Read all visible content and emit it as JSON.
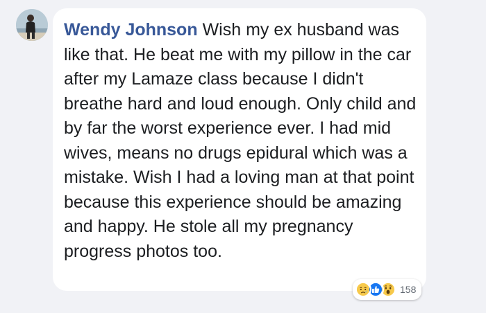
{
  "comment": {
    "author": "Wendy Johnson",
    "text": "Wish my ex husband was like that. He beat me with my pillow in the car after my Lamaze class because I didn't breathe hard and loud enough. Only child and by far the worst experience ever. I had mid wives, means no drugs epidural which was a mistake. Wish I had a loving man at that point because this experience should be amazing and happy. He stole all my pregnancy progress photos too."
  },
  "reactions": {
    "icons": [
      "sad-icon",
      "like-icon",
      "wow-icon"
    ],
    "count": "158"
  },
  "colors": {
    "background": "#f1f2f6",
    "bubble": "#ffffff",
    "author": "#385898",
    "text": "#1c1e21",
    "like_blue": "#1877f2",
    "emoji_yellow": "#f7c94b"
  }
}
